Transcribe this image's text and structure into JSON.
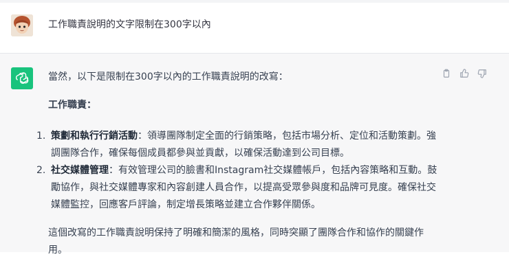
{
  "user": {
    "avatar": "user-avatar-cartoon",
    "message": "工作職責說明的文字限制在300字以內"
  },
  "assistant": {
    "avatar": "openai-logo-icon",
    "intro": "當然，以下是限制在300字以內的工作職責說明的改寫：",
    "heading": "工作職責：",
    "items": [
      {
        "num": "1.",
        "title": "策劃和執行行銷活動",
        "body": "：領導團隊制定全面的行銷策略，包括市場分析、定位和活動策劃。強調團隊合作，確保每個成員都參與並貢獻，以確保活動達到公司目標。"
      },
      {
        "num": "2.",
        "title": "社交媒體管理",
        "body": "：有效管理公司的臉書和Instagram社交媒體帳戶，包括內容策略和互動。鼓勵協作，與社交媒體專家和內容創建人員合作，以提高受眾參與度和品牌可見度。確保社交媒體監控，回應客戶評論，制定增長策略並建立合作夥伴關係。"
      }
    ],
    "closing": "這個改寫的工作職責說明保持了明確和簡潔的風格，同時突顯了團隊合作和協作的關鍵作用。"
  },
  "actions": [
    "clipboard-icon",
    "thumbs-up-icon",
    "thumbs-down-icon"
  ],
  "colors": {
    "bot_avatar_bg": "#19c37d",
    "assistant_bg": "#f7f7f8",
    "text": "#374151"
  }
}
